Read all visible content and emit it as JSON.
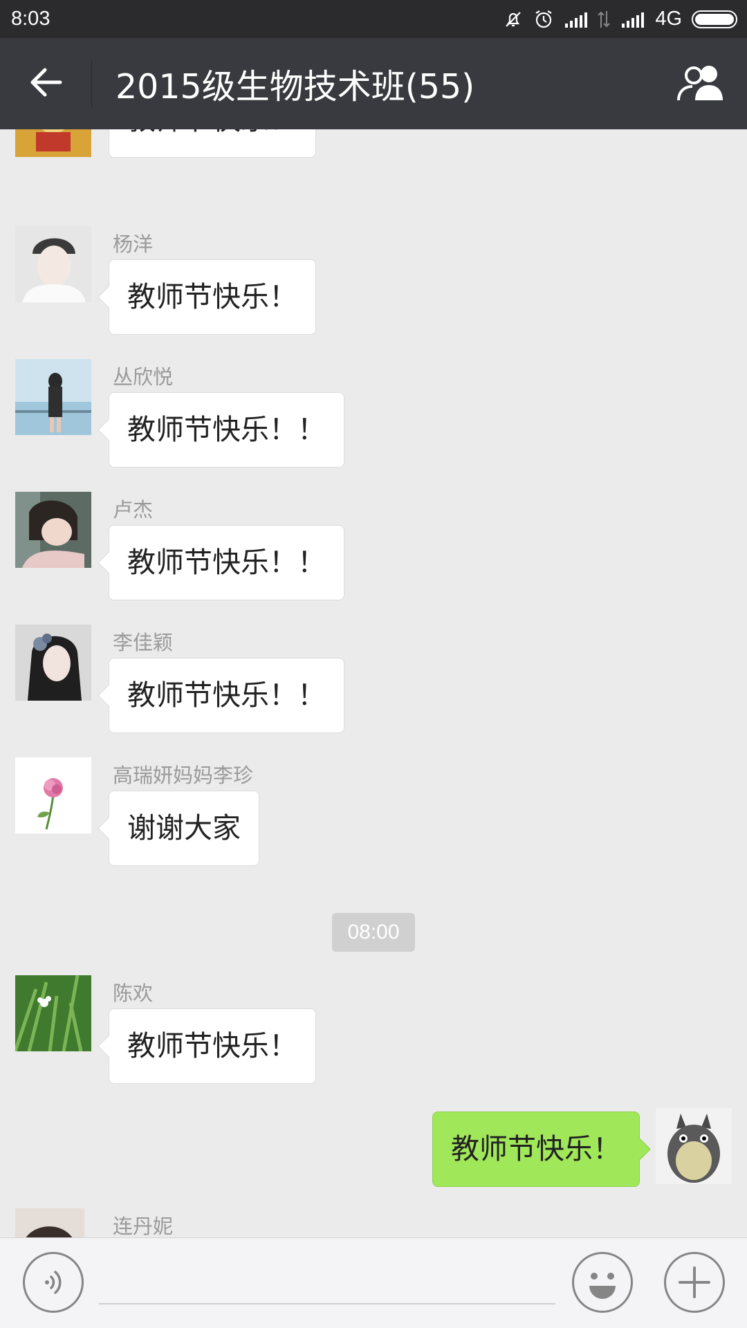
{
  "status_bar": {
    "time": "8:03",
    "network": "4G",
    "icons": [
      "mute-icon",
      "alarm-icon",
      "signal-icon",
      "data-icon",
      "signal-icon",
      "battery-icon"
    ]
  },
  "title_bar": {
    "title": "2015级生物技术班(55)",
    "back_icon": "back-arrow-icon",
    "members_icon": "group-members-icon"
  },
  "messages": [
    {
      "sender": "",
      "text": "教师节快乐！",
      "side": "left"
    },
    {
      "sender": "杨洋",
      "text": "教师节快乐！",
      "side": "left"
    },
    {
      "sender": "丛欣悦",
      "text": "教师节快乐！！",
      "side": "left"
    },
    {
      "sender": "卢杰",
      "text": "教师节快乐！！",
      "side": "left"
    },
    {
      "sender": "李佳颖",
      "text": "教师节快乐！！",
      "side": "left"
    },
    {
      "sender": "高瑞妍妈妈李珍",
      "text": "谢谢大家",
      "side": "left"
    },
    {
      "sender": "陈欢",
      "text": "教师节快乐！",
      "side": "left"
    },
    {
      "sender": "",
      "text": "教师节快乐！",
      "side": "right"
    },
    {
      "sender": "连丹妮",
      "text": "",
      "side": "left"
    }
  ],
  "timestamp": "08:00",
  "input_bar": {
    "voice_icon": "voice-icon",
    "emoji_icon": "emoji-icon",
    "plus_icon": "plus-icon",
    "input_value": ""
  },
  "colors": {
    "status_bar": "#2b2b2d",
    "title_bar": "#393a3f",
    "chat_bg": "#ebebeb",
    "my_bubble": "#a0e75a",
    "other_bubble": "#ffffff"
  }
}
